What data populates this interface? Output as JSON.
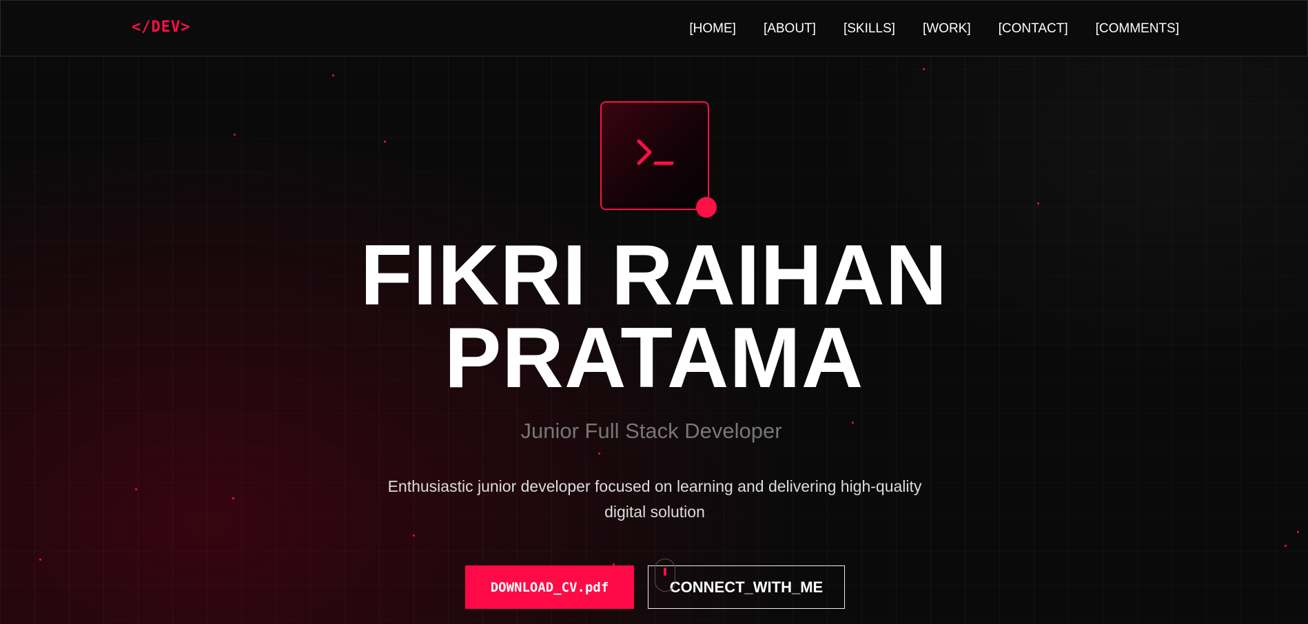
{
  "logo": "</DEV>",
  "nav": [
    "[HOME]",
    "[ABOUT]",
    "[SKILLS]",
    "[WORK]",
    "[CONTACT]",
    "[COMMENTS]"
  ],
  "hero": {
    "name_line1": "FIKRI RAIHAN",
    "name_line2": "PRATAMA",
    "role": "Junior Full Stack Developer",
    "description_line1": "Enthusiastic junior developer focused on learning and delivering high-quality",
    "description_line2": "digital solution",
    "primary_button": "DOWNLOAD_CV.pdf",
    "secondary_button": "CONNECT_WITH_ME"
  },
  "icons": {
    "logo": "code-brackets-logo",
    "hero": "terminal-prompt-icon",
    "scroll": "mouse-scroll-icon"
  },
  "colors": {
    "accent": "#ff1046",
    "background": "#0b0a0b",
    "text": "#ffffff",
    "muted": "#777777"
  }
}
